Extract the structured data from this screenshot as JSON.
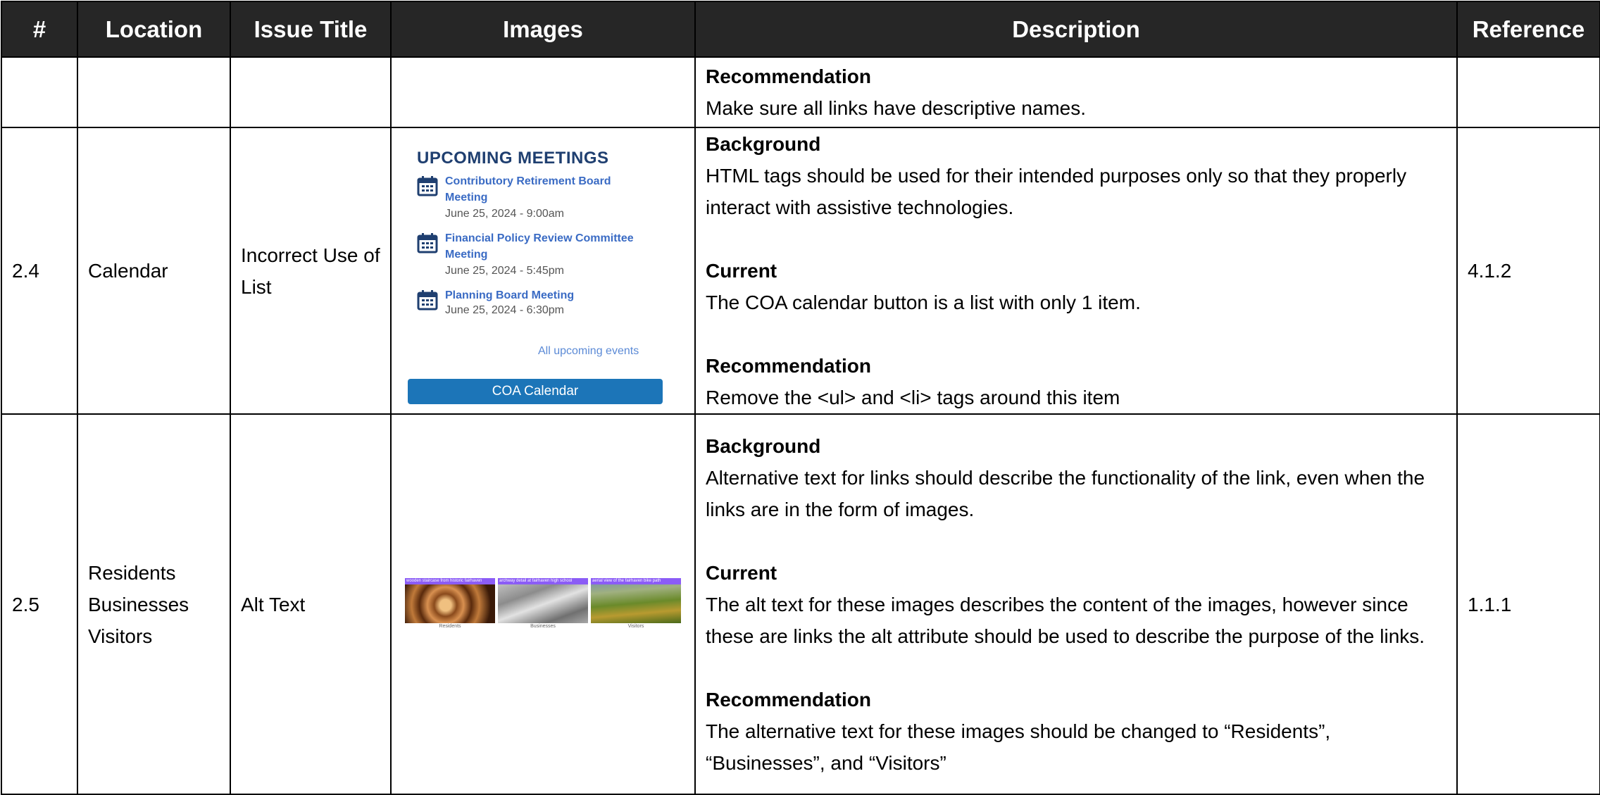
{
  "headers": [
    "#",
    "Location",
    "Issue Title",
    "Images",
    "Description",
    "Reference"
  ],
  "rows": [
    {
      "num": "",
      "location": "",
      "issue_title": "",
      "description": {
        "recommendation_heading": "Recommendation",
        "recommendation": "Make sure all links have descriptive names."
      },
      "reference": ""
    },
    {
      "num": "2.4",
      "location": "Calendar",
      "issue_title": "Incorrect Use of List",
      "image": {
        "title": "UPCOMING MEETINGS",
        "meetings": [
          {
            "name": "Contributory Retirement Board Meeting",
            "date": "June 25, 2024 - 9:00am"
          },
          {
            "name": "Financial Policy Review Committee Meeting",
            "date": "June 25, 2024 - 5:45pm"
          },
          {
            "name": "Planning Board Meeting",
            "date": "June 25, 2024 - 6:30pm"
          }
        ],
        "all_events_link": "All upcoming events",
        "button_label": "COA Calendar",
        "calendar_icon": "calendar-icon"
      },
      "description": {
        "background_heading": "Background",
        "background": "HTML tags should be used for their intended purposes only so that they properly interact with assistive technologies.",
        "current_heading": "Current",
        "current": "The COA calendar button is a list with only 1 item.",
        "recommendation_heading": "Recommendation",
        "recommendation": "Remove the <ul> and <li> tags around this item"
      },
      "reference": "4.1.2"
    },
    {
      "num": "2.5",
      "location_lines": [
        "Residents",
        "Businesses",
        "Visitors"
      ],
      "issue_title": "Alt Text",
      "image": {
        "thumbnails": [
          {
            "caption": "Residents",
            "overlay": "wooden staircase from historic fairhaven"
          },
          {
            "caption": "Businesses",
            "overlay": "archway detail at fairhaven high school"
          },
          {
            "caption": "Visitors",
            "overlay": "aerial view of the fairhaven bike path"
          }
        ]
      },
      "description": {
        "background_heading": "Background",
        "background": "Alternative text for links should describe the functionality of the link, even when the links are in the form of images.",
        "current_heading": "Current",
        "current": "The alt text for these images describes the content of the images, however since these are links the alt attribute should be used to describe the purpose of the links.",
        "recommendation_heading": "Recommendation",
        "recommendation": "The alternative text for these images should be changed to “Residents”, “Businesses”, and “Visitors”"
      },
      "reference": "1.1.1"
    }
  ]
}
